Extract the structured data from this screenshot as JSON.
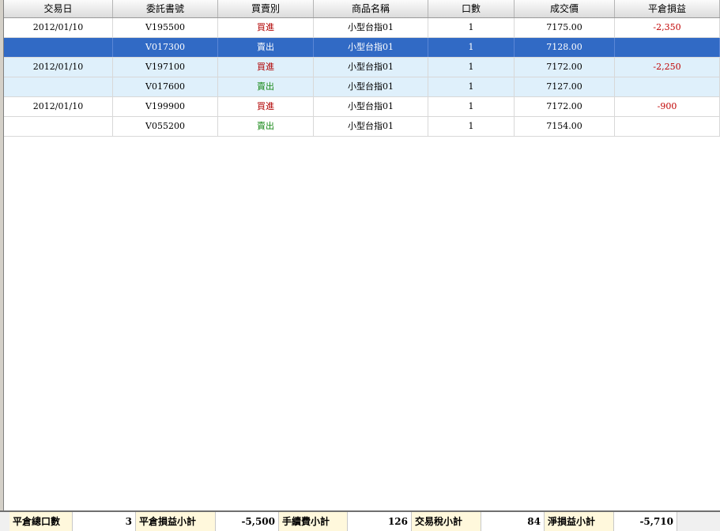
{
  "columns": [
    "交易日",
    "委託書號",
    "買賣別",
    "商品名稱",
    "口數",
    "成交價",
    "平倉損益"
  ],
  "rows": [
    {
      "date": "2012/01/10",
      "order": "V195500",
      "side": "買進",
      "side_type": "buy",
      "product": "小型台指01",
      "qty": "1",
      "price": "7175.00",
      "pnl": "-2,350"
    },
    {
      "date": "",
      "order": "V017300",
      "side": "賣出",
      "side_type": "sell",
      "product": "小型台指01",
      "qty": "1",
      "price": "7128.00",
      "pnl": ""
    },
    {
      "date": "2012/01/10",
      "order": "V197100",
      "side": "買進",
      "side_type": "buy",
      "product": "小型台指01",
      "qty": "1",
      "price": "7172.00",
      "pnl": "-2,250"
    },
    {
      "date": "",
      "order": "V017600",
      "side": "賣出",
      "side_type": "sell",
      "product": "小型台指01",
      "qty": "1",
      "price": "7127.00",
      "pnl": ""
    },
    {
      "date": "2012/01/10",
      "order": "V199900",
      "side": "買進",
      "side_type": "buy",
      "product": "小型台指01",
      "qty": "1",
      "price": "7172.00",
      "pnl": "-900"
    },
    {
      "date": "",
      "order": "V055200",
      "side": "賣出",
      "side_type": "sell",
      "product": "小型台指01",
      "qty": "1",
      "price": "7154.00",
      "pnl": ""
    }
  ],
  "selected_row": 1,
  "footer": {
    "total_lots_label": "平倉總口數",
    "total_lots": "3",
    "pnl_subtotal_label": "平倉損益小計",
    "pnl_subtotal": "-5,500",
    "fee_subtotal_label": "手續費小計",
    "fee_subtotal": "126",
    "tax_subtotal_label": "交易稅小計",
    "tax_subtotal": "84",
    "net_pnl_label": "淨損益小計",
    "net_pnl": "-5,710"
  },
  "colors": {
    "buy": "#b00000",
    "sell": "#1a8a1a",
    "selection": "#316ac5",
    "alt_row": "#dff0fb",
    "footer_label_bg": "#fff8dc"
  }
}
